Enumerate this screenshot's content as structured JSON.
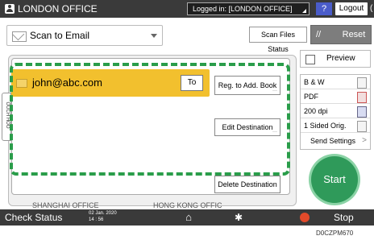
{
  "topbar": {
    "title": "LONDON OFFICE",
    "logged_in": "Logged in: [LONDON OFFICE]",
    "help": "?",
    "logout": "Logout",
    "theme_glyph": "("
  },
  "toolbar": {
    "send_type": "Scan to Email",
    "scan_files_status": "Scan Files Status",
    "reset": "Reset"
  },
  "destination": {
    "email": "john@abc.com",
    "to": "To",
    "reg_add_book": "Reg. to Add. Book",
    "edit": "Edit Destination",
    "delete": "Delete Destination",
    "side_tab": "OUCH HOO"
  },
  "peek": {
    "left": "SHANGHAI OFFICE",
    "right": "HONG KONG OFFIC"
  },
  "right_panel": {
    "preview": "Preview",
    "settings": [
      "B & W",
      "PDF",
      "200 dpi",
      "1 Sided Orig."
    ],
    "send_settings": "Send Settings",
    "start": "Start"
  },
  "bottombar": {
    "check_status": "Check Status",
    "date": "02 Jan. 2020",
    "time": "14 : 56",
    "stop": "Stop"
  },
  "figure_code": "D0CZPM670"
}
